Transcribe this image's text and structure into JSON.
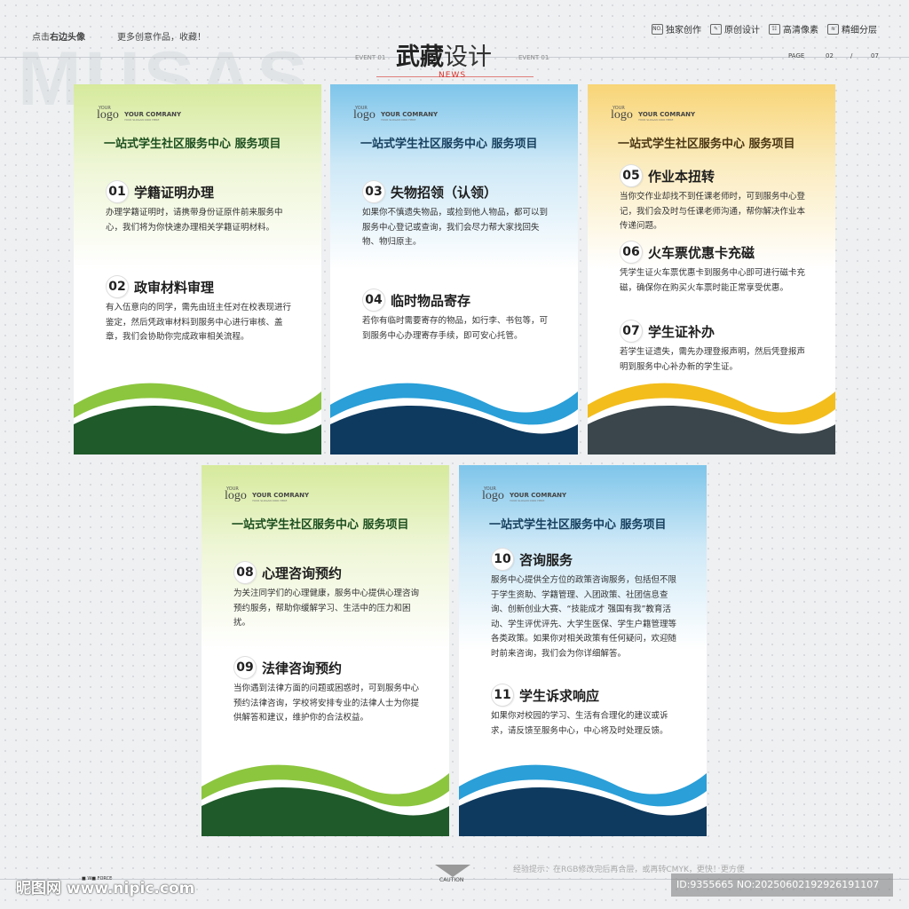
{
  "header": {
    "left_prefix": "点击",
    "left_bold": "右边头像",
    "left_secondary": "更多创意作品，收藏！",
    "watermark": "MUSAS",
    "title_bold": "武藏",
    "title_light": "设计",
    "event_left": "EVENT 01",
    "event_right": "EVENT 01",
    "news": "NEWS",
    "badges": [
      {
        "icon": "NO.",
        "label": "独家创作"
      },
      {
        "icon": "✎",
        "label": "原创设计"
      },
      {
        "icon": "☷",
        "label": "高清像素"
      },
      {
        "icon": "≋",
        "label": "精细分层"
      }
    ],
    "page_label": "PAGE",
    "page_current": "02",
    "page_sep": "/",
    "page_total": "07"
  },
  "logo": {
    "your": "YOUR",
    "word": "logo",
    "company": "YOUR COMRANY",
    "slogan": "YOUR SLOGAN 0000 HERE"
  },
  "colors": {
    "green_dark": "#1f5a2a",
    "green_light": "#8cc63f",
    "blue_dark": "#0f3a5f",
    "blue_light": "#2a9fd8",
    "gold_dark": "#3a464b",
    "gold_light": "#f3bd1c"
  },
  "panels": [
    {
      "heading": "一站式学生社区服务中心  服务项目",
      "items": [
        {
          "num": "01",
          "title": "学籍证明办理",
          "body": "办理学籍证明时，请携带身份证原件前来服务中心，我们将为你快速办理相关学籍证明材料。"
        },
        {
          "num": "02",
          "title": "政审材料审理",
          "body": "有入伍意向的同学，需先由班主任对在校表现进行鉴定，然后凭政审材料到服务中心进行审核、盖章，我们会协助你完成政审相关流程。"
        }
      ]
    },
    {
      "heading": "一站式学生社区服务中心  服务项目",
      "items": [
        {
          "num": "03",
          "title": "失物招领（认领）",
          "body": "如果你不慎遗失物品，或捡到他人物品，都可以到服务中心登记或查询，我们会尽力帮大家找回失物、物归原主。"
        },
        {
          "num": "04",
          "title": "临时物品寄存",
          "body": "若你有临时需要寄存的物品，如行李、书包等，可到服务中心办理寄存手续，即可安心托管。"
        }
      ]
    },
    {
      "heading": "一站式学生社区服务中心  服务项目",
      "items": [
        {
          "num": "05",
          "title": "作业本扭转",
          "body": "当你交作业却找不到任课老师时，可到服务中心登记，我们会及时与任课老师沟通，帮你解决作业本传递问题。"
        },
        {
          "num": "06",
          "title": "火车票优惠卡充磁",
          "body": "凭学生证火车票优惠卡到服务中心即可进行磁卡充磁，确保你在购买火车票时能正常享受优惠。"
        },
        {
          "num": "07",
          "title": "学生证补办",
          "body": "若学生证遗失，需先办理登报声明，然后凭登报声明到服务中心补办新的学生证。"
        }
      ]
    },
    {
      "heading": "一站式学生社区服务中心  服务项目",
      "items": [
        {
          "num": "08",
          "title": "心理咨询预约",
          "body": "为关注同学们的心理健康，服务中心提供心理咨询预约服务，帮助你缓解学习、生活中的压力和困扰。"
        },
        {
          "num": "09",
          "title": "法律咨询预约",
          "body": "当你遇到法律方面的问题或困惑时，可到服务中心预约法律咨询，学校将安排专业的法律人士为你提供解答和建议，维护你的合法权益。"
        }
      ]
    },
    {
      "heading": "一站式学生社区服务中心  服务项目",
      "items": [
        {
          "num": "10",
          "title": "咨询服务",
          "body": "服务中心提供全方位的政策咨询服务，包括但不限于学生资助、学籍管理、入团政策、社团信息查询、创新创业大赛、“技能成才 强国有我”教育活动、学生评优评先、大学生医保、学生户籍管理等各类政策。如果你对相关政策有任何疑问，欢迎随时前来咨询，我们会为你详细解答。"
        },
        {
          "num": "11",
          "title": "学生诉求响应",
          "body": "如果你对校园的学习、生活有合理化的建议或诉求，请反馈至服务中心，中心将及时处理反馈。"
        }
      ]
    }
  ],
  "footer": {
    "tip": "经验提示：在RGB修改完后再合层，或再转CMYK，更快！更方便",
    "caution": "CAUTION",
    "force": "■ W■ FORCE",
    "site": "昵图网 www.nipic.com",
    "id_text": "ID:9355665 NO:20250602192926191107"
  }
}
